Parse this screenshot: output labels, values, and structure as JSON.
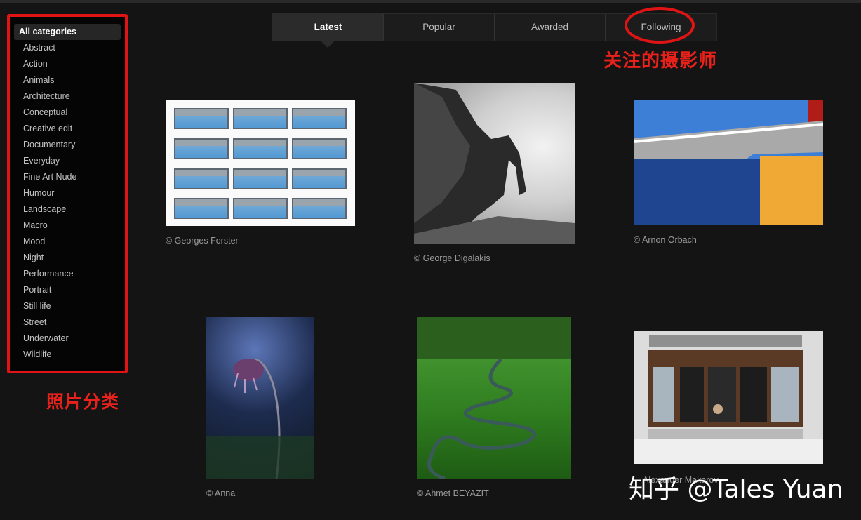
{
  "sidebar": {
    "items": [
      {
        "label": "All categories",
        "active": true
      },
      {
        "label": "Abstract"
      },
      {
        "label": "Action"
      },
      {
        "label": "Animals"
      },
      {
        "label": "Architecture"
      },
      {
        "label": "Conceptual"
      },
      {
        "label": "Creative edit"
      },
      {
        "label": "Documentary"
      },
      {
        "label": "Everyday"
      },
      {
        "label": "Fine Art Nude"
      },
      {
        "label": "Humour"
      },
      {
        "label": "Landscape"
      },
      {
        "label": "Macro"
      },
      {
        "label": "Mood"
      },
      {
        "label": "Night"
      },
      {
        "label": "Performance"
      },
      {
        "label": "Portrait"
      },
      {
        "label": "Still life"
      },
      {
        "label": "Street"
      },
      {
        "label": "Underwater"
      },
      {
        "label": "Wildlife"
      }
    ]
  },
  "tabs": [
    {
      "label": "Latest",
      "active": true
    },
    {
      "label": "Popular"
    },
    {
      "label": "Awarded"
    },
    {
      "label": "Following"
    }
  ],
  "annotations": {
    "categories": "照片分类",
    "following": "关注的摄影师",
    "color": "#e01414"
  },
  "photos": [
    {
      "caption": "© Georges Forster",
      "icon": "building-photo"
    },
    {
      "caption": "© George Digalakis",
      "icon": "sea-arch-photo"
    },
    {
      "caption": "© Arnon Orbach",
      "icon": "wall-photo"
    },
    {
      "caption": "© Anna",
      "icon": "flower-photo"
    },
    {
      "caption": "© Ahmet BEYAZIT",
      "icon": "river-photo"
    },
    {
      "caption": "Alexander Makarov",
      "icon": "window-photo"
    }
  ],
  "watermark": "知乎 @Tales Yuan"
}
